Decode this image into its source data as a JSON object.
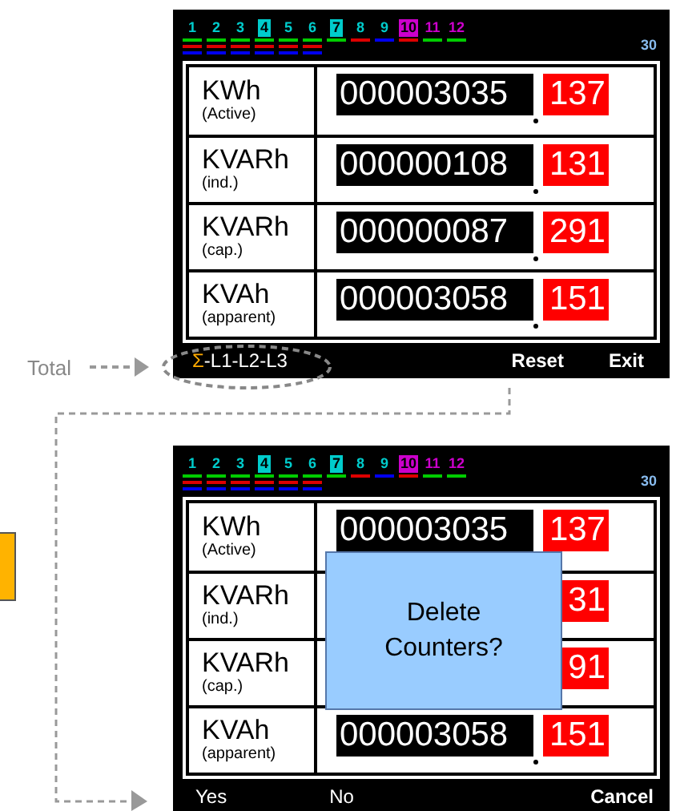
{
  "total_label": "Total",
  "screens": [
    {
      "tabs": [
        {
          "label": "1",
          "color": "#00cccc",
          "highlighted": false,
          "lines": [
            {
              "color": "#00cc00"
            },
            {
              "color": "#dd0000"
            },
            {
              "color": "#0000ee"
            }
          ]
        },
        {
          "label": "2",
          "color": "#00cccc",
          "highlighted": false,
          "lines": [
            {
              "color": "#00cc00"
            },
            {
              "color": "#dd0000"
            },
            {
              "color": "#0000ee"
            }
          ]
        },
        {
          "label": "3",
          "color": "#00cccc",
          "highlighted": false,
          "lines": [
            {
              "color": "#00cc00"
            },
            {
              "color": "#dd0000"
            },
            {
              "color": "#0000ee"
            }
          ]
        },
        {
          "label": "4",
          "color": "#00cccc",
          "highlighted": true,
          "lines": [
            {
              "color": "#00cc00"
            },
            {
              "color": "#dd0000"
            },
            {
              "color": "#0000ee"
            }
          ]
        },
        {
          "label": "5",
          "color": "#00cccc",
          "highlighted": false,
          "lines": [
            {
              "color": "#00cc00"
            },
            {
              "color": "#dd0000"
            },
            {
              "color": "#0000ee"
            }
          ]
        },
        {
          "label": "6",
          "color": "#00cccc",
          "highlighted": false,
          "lines": [
            {
              "color": "#00cc00"
            },
            {
              "color": "#dd0000"
            },
            {
              "color": "#0000ee"
            }
          ]
        },
        {
          "label": "7",
          "color": "#00cccc",
          "highlighted": true,
          "lines": [
            {
              "color": "#00cc00"
            }
          ]
        },
        {
          "label": "8",
          "color": "#00cccc",
          "highlighted": false,
          "lines": [
            {
              "color": "#dd0000"
            }
          ]
        },
        {
          "label": "9",
          "color": "#00cccc",
          "highlighted": false,
          "lines": [
            {
              "color": "#0000ee"
            }
          ]
        },
        {
          "label": "10",
          "color": "#cc00cc",
          "highlighted": true,
          "lines": [
            {
              "color": "#dd0000"
            }
          ]
        },
        {
          "label": "11",
          "color": "#cc00cc",
          "highlighted": false,
          "lines": [
            {
              "color": "#00cc00"
            }
          ]
        },
        {
          "label": "12",
          "color": "#cc00cc",
          "highlighted": false,
          "lines": [
            {
              "color": "#00cc00"
            }
          ]
        }
      ],
      "corner_value": "30",
      "rows": [
        {
          "unit": "KWh",
          "sub": "(Active)",
          "value": "000003035",
          "fraction": "137"
        },
        {
          "unit": "KVARh",
          "sub": "(ind.)",
          "value": "000000108",
          "fraction": "131"
        },
        {
          "unit": "KVARh",
          "sub": "(cap.)",
          "value": "000000087",
          "fraction": "291"
        },
        {
          "unit": "KVAh",
          "sub": "(apparent)",
          "value": "000003058",
          "fraction": "151"
        }
      ],
      "footer": [
        {
          "kind": "phase",
          "symbol": "Σ",
          "text": "-L1-L2-L3"
        },
        {
          "kind": "button",
          "text": "Reset"
        },
        {
          "kind": "button",
          "text": "Exit"
        }
      ]
    },
    {
      "tabs": [
        {
          "label": "1",
          "color": "#00cccc",
          "highlighted": false,
          "lines": [
            {
              "color": "#00cc00"
            },
            {
              "color": "#dd0000"
            },
            {
              "color": "#0000ee"
            }
          ]
        },
        {
          "label": "2",
          "color": "#00cccc",
          "highlighted": false,
          "lines": [
            {
              "color": "#00cc00"
            },
            {
              "color": "#dd0000"
            },
            {
              "color": "#0000ee"
            }
          ]
        },
        {
          "label": "3",
          "color": "#00cccc",
          "highlighted": false,
          "lines": [
            {
              "color": "#00cc00"
            },
            {
              "color": "#dd0000"
            },
            {
              "color": "#0000ee"
            }
          ]
        },
        {
          "label": "4",
          "color": "#00cccc",
          "highlighted": true,
          "lines": [
            {
              "color": "#00cc00"
            },
            {
              "color": "#dd0000"
            },
            {
              "color": "#0000ee"
            }
          ]
        },
        {
          "label": "5",
          "color": "#00cccc",
          "highlighted": false,
          "lines": [
            {
              "color": "#00cc00"
            },
            {
              "color": "#dd0000"
            },
            {
              "color": "#0000ee"
            }
          ]
        },
        {
          "label": "6",
          "color": "#00cccc",
          "highlighted": false,
          "lines": [
            {
              "color": "#00cc00"
            },
            {
              "color": "#dd0000"
            },
            {
              "color": "#0000ee"
            }
          ]
        },
        {
          "label": "7",
          "color": "#00cccc",
          "highlighted": true,
          "lines": [
            {
              "color": "#00cc00"
            }
          ]
        },
        {
          "label": "8",
          "color": "#00cccc",
          "highlighted": false,
          "lines": [
            {
              "color": "#dd0000"
            }
          ]
        },
        {
          "label": "9",
          "color": "#00cccc",
          "highlighted": false,
          "lines": [
            {
              "color": "#0000ee"
            }
          ]
        },
        {
          "label": "10",
          "color": "#cc00cc",
          "highlighted": true,
          "lines": [
            {
              "color": "#dd0000"
            }
          ]
        },
        {
          "label": "11",
          "color": "#cc00cc",
          "highlighted": false,
          "lines": [
            {
              "color": "#00cc00"
            }
          ]
        },
        {
          "label": "12",
          "color": "#cc00cc",
          "highlighted": false,
          "lines": [
            {
              "color": "#00cc00"
            }
          ]
        }
      ],
      "corner_value": "30",
      "rows": [
        {
          "unit": "KWh",
          "sub": "(Active)",
          "value": "000003035",
          "fraction": "137"
        },
        {
          "unit": "KVARh",
          "sub": "(ind.)",
          "fraction": "31"
        },
        {
          "unit": "KVARh",
          "sub": "(cap.)",
          "fraction": "91"
        },
        {
          "unit": "KVAh",
          "sub": "(apparent)",
          "value": "000003058",
          "fraction": "151"
        }
      ],
      "dialog": {
        "message": "Delete Counters?"
      },
      "footer": [
        {
          "kind": "button",
          "text": "Yes"
        },
        {
          "kind": "button",
          "text": "No"
        },
        {
          "kind": "button",
          "text": "Cancel"
        }
      ]
    }
  ]
}
